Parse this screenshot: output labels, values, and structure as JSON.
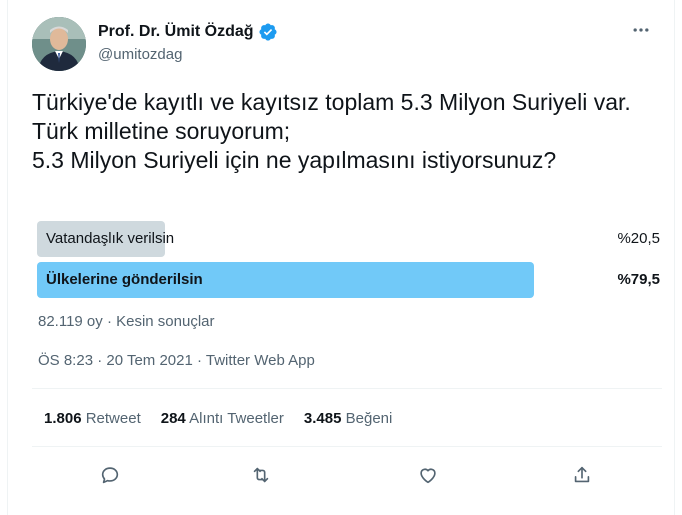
{
  "author": {
    "display_name": "Prof. Dr. Ümit Özdağ",
    "handle": "@umitozdag",
    "verified_icon": "verified-badge-icon"
  },
  "more_icon": "more-horizontal-icon",
  "tweet": {
    "text": "Türkiye'de kayıtlı ve kayıtsız toplam 5.3 Milyon Suriyeli var.\nTürk milletine soruyorum;\n5.3 Milyon Suriyeli için ne yapılmasını istiyorsunuz?"
  },
  "poll": {
    "options": [
      {
        "label": "Vatandaşlık verilsin",
        "percent_text": "%20,5",
        "fraction": 0.205,
        "winner": false
      },
      {
        "label": "Ülkelerine gönderilsin",
        "percent_text": "%79,5",
        "fraction": 0.795,
        "winner": true
      }
    ],
    "meta": "82.119 oy · Kesin sonuçlar",
    "colors": {
      "winner": "#71c9f8",
      "loser": "#cfd9de"
    }
  },
  "timestamp": "ÖS 8:23 · 20 Tem 2021 · Twitter Web App",
  "stats": {
    "retweets_count": "1.806",
    "retweets_label": "Retweet",
    "quotes_count": "284",
    "quotes_label": "Alıntı Tweetler",
    "likes_count": "3.485",
    "likes_label": "Beğeni"
  },
  "actions": [
    "reply-icon",
    "retweet-icon",
    "like-icon",
    "share-icon"
  ],
  "colors": {
    "accent": "#1d9bf0",
    "secondary_text": "#536471"
  }
}
